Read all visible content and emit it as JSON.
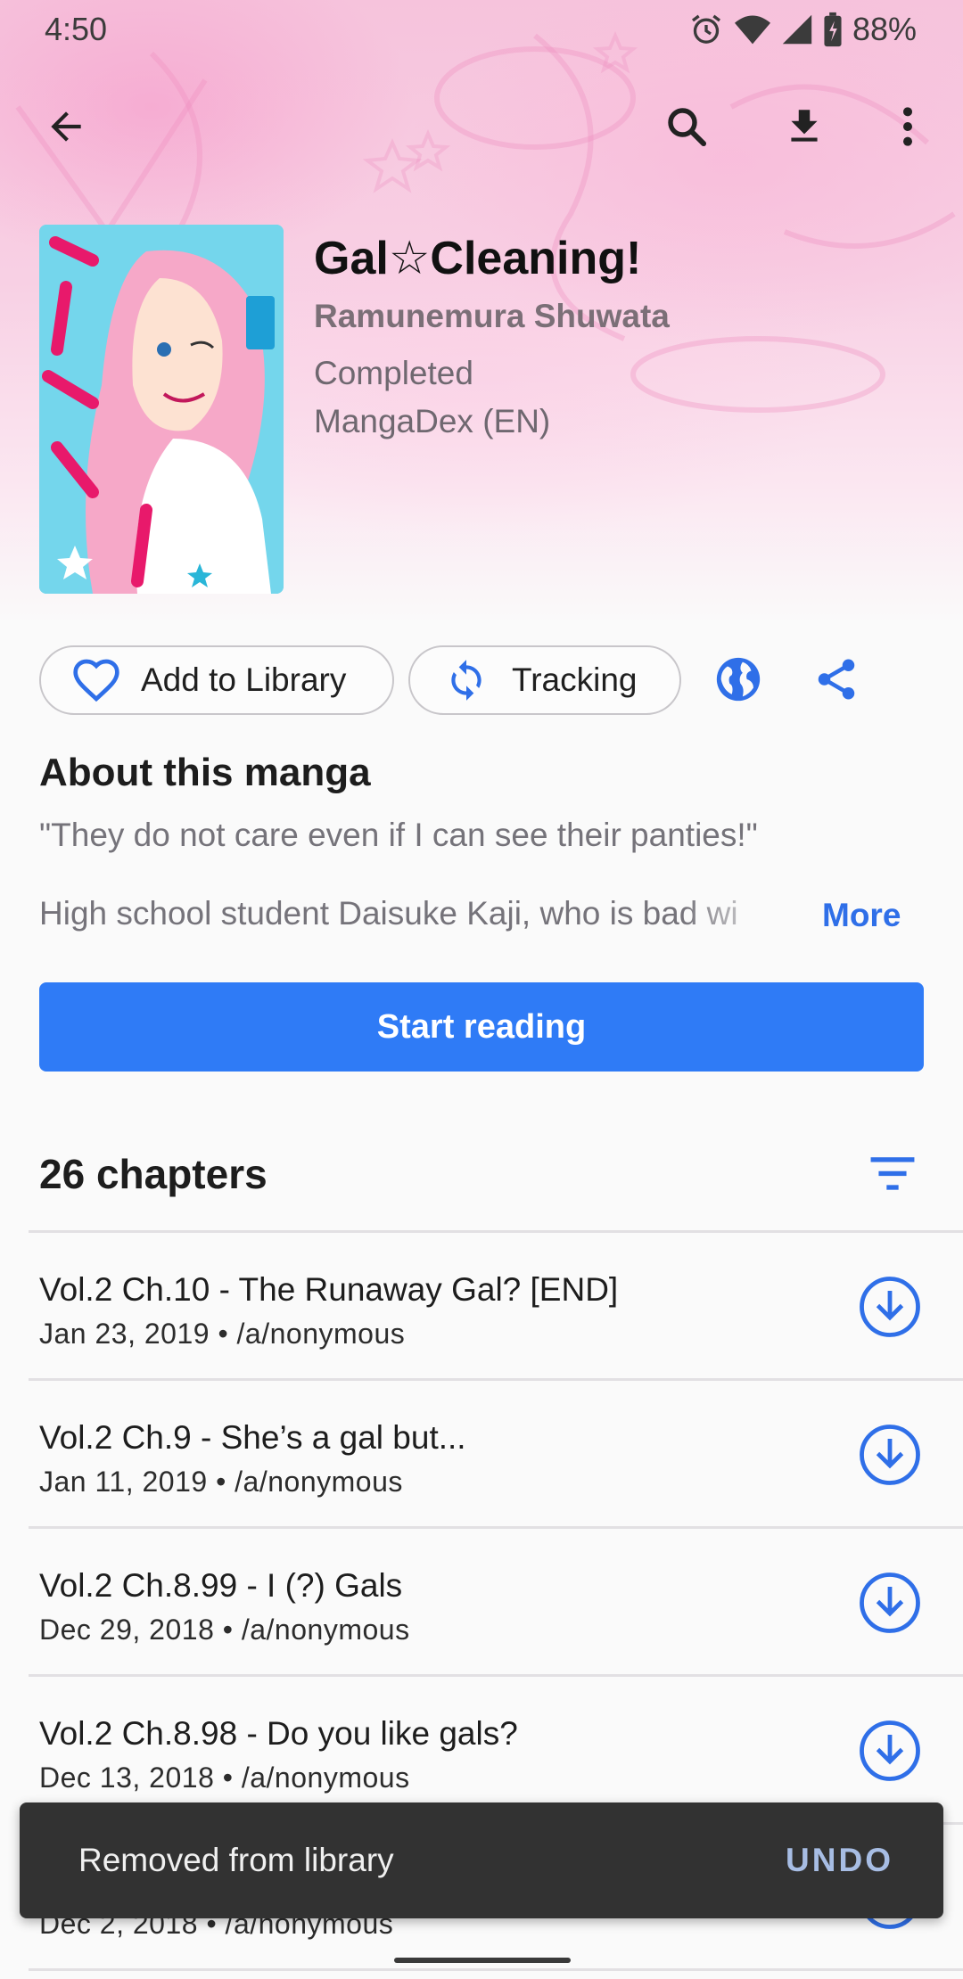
{
  "status_bar": {
    "time": "4:50",
    "battery": "88%",
    "icons": [
      "alarm-icon",
      "wifi-icon",
      "signal-icon",
      "battery-icon"
    ]
  },
  "toolbar": {
    "icons": [
      "back-arrow-icon",
      "search-icon",
      "download-icon",
      "more-vert-icon"
    ]
  },
  "manga": {
    "title": "Gal☆Cleaning!",
    "author": "Ramunemura Shuwata",
    "status": "Completed",
    "source": "MangaDex (EN)",
    "cover_icon": "cover-art"
  },
  "actions": {
    "library_label": "Add to Library",
    "tracking_label": "Tracking",
    "icons": [
      "heart-outline-icon",
      "sync-icon",
      "globe-icon",
      "share-icon"
    ]
  },
  "about": {
    "title": "About this manga",
    "quote": "\"They do not care even if I can see their panties!\"",
    "description": "High school student Daisuke Kaji, who is bad wi",
    "more_label": "More"
  },
  "start_button": {
    "label": "Start reading"
  },
  "chapters": {
    "count_label": "26 chapters",
    "items": [
      {
        "name": "Vol.2 Ch.10 - The Runaway Gal? [END]",
        "meta": "Jan 23, 2019 • /a/nonymous"
      },
      {
        "name": "Vol.2 Ch.9 - She’s a gal but...",
        "meta": "Jan 11, 2019 • /a/nonymous"
      },
      {
        "name": "Vol.2 Ch.8.99 - I (?) Gals",
        "meta": "Dec 29, 2018 • /a/nonymous"
      },
      {
        "name": "Vol.2 Ch.8.98 - Do you like gals?",
        "meta": "Dec 13, 2018 • /a/nonymous"
      },
      {
        "name": "",
        "meta": "Dec 2, 2018 • /a/nonymous"
      }
    ]
  },
  "snackbar": {
    "message": "Removed from library",
    "action": "UNDO"
  },
  "colors": {
    "accent": "#2f7bf6",
    "link": "#2f6fe8",
    "snackbar_bg": "#323232",
    "header_tint": "#f6c3dc"
  }
}
